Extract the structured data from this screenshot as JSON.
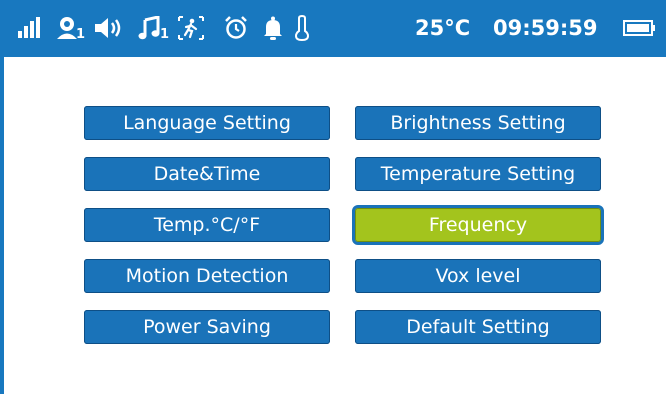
{
  "status_bar": {
    "temperature": "25°C",
    "time": "09:59:59",
    "camera_index": "1",
    "music_index": "1",
    "icons": [
      "signal-icon",
      "camera-icon",
      "speaker-volume-icon",
      "music-icon",
      "motion-detection-icon",
      "alarm-clock-icon",
      "bell-icon",
      "thermometer-icon",
      "battery-icon"
    ]
  },
  "menu": {
    "selected": "Frequency",
    "items": [
      {
        "label": "Language Setting"
      },
      {
        "label": "Brightness Setting"
      },
      {
        "label": "Date&Time"
      },
      {
        "label": "Temperature Setting"
      },
      {
        "label": "Temp.°C/°F"
      },
      {
        "label": "Frequency"
      },
      {
        "label": "Motion Detection"
      },
      {
        "label": "Vox level"
      },
      {
        "label": "Power Saving"
      },
      {
        "label": "Default Setting"
      }
    ]
  },
  "colors": {
    "status_bar": "#1878bf",
    "button": "#1a73b9",
    "button_selected": "#a3c41d",
    "text": "#ffffff"
  }
}
